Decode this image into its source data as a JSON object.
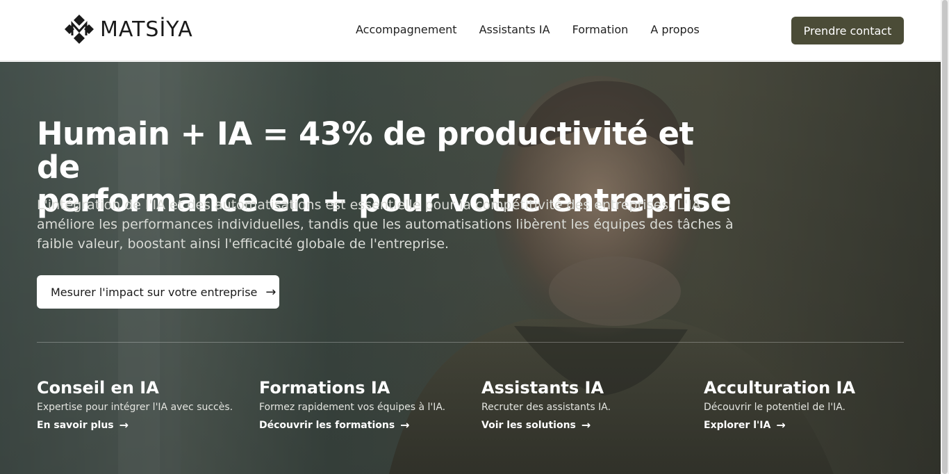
{
  "header": {
    "logo_text": "MATSİYA",
    "nav": [
      "Accompagnement",
      "Assistants IA",
      "Formation",
      "A propos"
    ],
    "cta": "Prendre contact",
    "cta_color": "#4b4c37"
  },
  "hero": {
    "headline_line1": "Humain + IA = 43% de productivité et de",
    "headline_line2": "performance en + pour votre entreprise",
    "subline": "L'intégration de l'IA et des automatisations est essentielle pour la compétitivité des entreprises. L'IA améliore les performances individuelles, tandis que les automatisations libèrent les équipes des tâches à faible valeur, boostant ainsi l'efficacité globale de l'entreprise.",
    "cta": "Mesurer l'impact sur votre entreprise",
    "cta_icon": "arrow-right-icon"
  },
  "cards": [
    {
      "title": "Conseil en IA",
      "text": "Expertise pour intégrer l'IA avec succès.",
      "link": "En savoir plus"
    },
    {
      "title": "Formations IA",
      "text": "Formez rapidement vos équipes à l'IA.",
      "link": "Découvrir les formations"
    },
    {
      "title": "Assistants IA",
      "text": "Recruter des assistants IA.",
      "link": "Voir les solutions"
    },
    {
      "title": "Acculturation IA",
      "text": "Découvrir le potentiel de l'IA.",
      "link": "Explorer l'IA"
    }
  ]
}
